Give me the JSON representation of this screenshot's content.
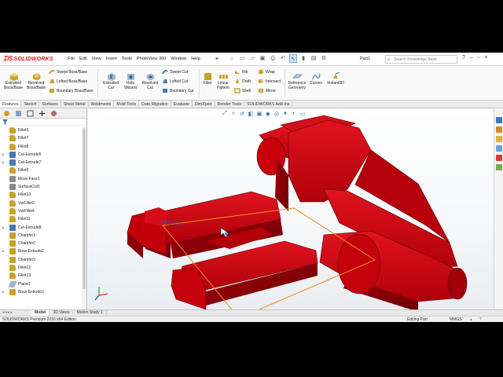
{
  "app": {
    "name": "SOLIDWORKS",
    "doc_name": "Part1",
    "search_placeholder": "Search Knowledge Base"
  },
  "menu": [
    "File",
    "Edit",
    "View",
    "Insert",
    "Tools",
    "PhotoView 360",
    "Window",
    "Help"
  ],
  "commands": {
    "extruded_boss": "Extruded Boss/Base",
    "revolved_boss": "Revolved Boss/Base",
    "swept_boss": "Swept Boss/Base",
    "lofted_boss": "Lofted Boss/Base",
    "boundary_boss": "Boundary Boss/Base",
    "extruded_cut": "Extruded Cut",
    "hole_wizard": "Hole Wizard",
    "revolved_cut": "Revolved Cut",
    "swept_cut": "Swept Cut",
    "lofted_cut": "Lofted Cut",
    "boundary_cut": "Boundary Cut",
    "fillet": "Fillet",
    "linear_pattern": "Linear Pattern",
    "rib": "Rib",
    "draft": "Draft",
    "shell": "Shell",
    "wrap": "Wrap",
    "intersect": "Intersect",
    "mirror": "Mirror",
    "reference_geometry": "Reference Geometry",
    "curves": "Curves",
    "instant3d": "Instant3D"
  },
  "tabs": [
    "Features",
    "Sketch",
    "Surfaces",
    "Sheet Metal",
    "Weldments",
    "Mold Tools",
    "Data Migration",
    "Evaluate",
    "DimXpert",
    "Render Tools",
    "SOLIDWORKS Add-Ins"
  ],
  "tree": [
    {
      "label": "Fillet5",
      "expand": false,
      "icon": "fillet"
    },
    {
      "label": "Fillet7",
      "expand": false,
      "icon": "fillet"
    },
    {
      "label": "Fillet8",
      "expand": false,
      "icon": "fillet"
    },
    {
      "label": "Cut-Extrude5",
      "expand": true,
      "icon": "cut"
    },
    {
      "label": "Cut-Extrude7",
      "expand": true,
      "icon": "cut"
    },
    {
      "label": "Fillet9",
      "expand": false,
      "icon": "fillet"
    },
    {
      "label": "Move Face1",
      "expand": false,
      "icon": "face"
    },
    {
      "label": "SurfaceCut1",
      "expand": false,
      "icon": "face"
    },
    {
      "label": "Fillet10",
      "expand": false,
      "icon": "fillet"
    },
    {
      "label": "VarFillet3",
      "expand": false,
      "icon": "fillet"
    },
    {
      "label": "VarFillet4",
      "expand": false,
      "icon": "fillet"
    },
    {
      "label": "Fillet11",
      "expand": false,
      "icon": "fillet"
    },
    {
      "label": "Cut-Extrude8",
      "expand": true,
      "icon": "cut"
    },
    {
      "label": "Chamfer1",
      "expand": false,
      "icon": "chamfer"
    },
    {
      "label": "Chamfer2",
      "expand": false,
      "icon": "chamfer"
    },
    {
      "label": "Boss-Extrude2",
      "expand": true,
      "icon": "boss"
    },
    {
      "label": "Chamfer3",
      "expand": false,
      "icon": "chamfer"
    },
    {
      "label": "Fillet12",
      "expand": false,
      "icon": "fillet"
    },
    {
      "label": "Fillet13",
      "expand": false,
      "icon": "fillet"
    },
    {
      "label": "Plane1",
      "expand": false,
      "icon": "plane"
    },
    {
      "label": "Boss-Extrude3",
      "expand": true,
      "icon": "boss"
    }
  ],
  "viewport": {
    "plane_label": "Plane1",
    "model_color": "#c0000b"
  },
  "bottom_tabs": [
    "Model",
    "3D Views",
    "Motion Study 1"
  ],
  "status": {
    "edition": "SOLIDWORKS Premium 2016 x64 Edition",
    "mode": "Editing Part",
    "units": "MMGS"
  }
}
